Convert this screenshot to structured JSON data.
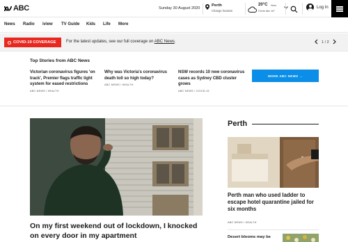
{
  "header": {
    "logo_text": "ABC",
    "date": "Sunday 30 August 2020",
    "location_name": "Perth",
    "location_change": "Change location",
    "temperature": "20°C",
    "temperature_note": "Now",
    "feels_like": "Feels like 16°",
    "login_label": "Log In"
  },
  "nav": {
    "items": [
      "News",
      "Radio",
      "iview",
      "TV Guide",
      "Kids",
      "Life",
      "More"
    ]
  },
  "banner": {
    "badge": "COVID-19 COVERAGE",
    "text": "For the latest updates, see our full coverage on",
    "link": "ABC News",
    "text_end": ".",
    "page": "1 / 2"
  },
  "top_stories": {
    "heading": "Top Stories from ABC News",
    "stories": [
      {
        "title": "Victorian coronavirus figures 'on track', Premier flags traffic light system for eased restrictions",
        "tags": "ABC NEWS  /  HEALTH"
      },
      {
        "title": "Why was Victoria's coronavirus death toll so high today?",
        "tags": "ABC NEWS  /  HEALTH"
      },
      {
        "title": "NSW records 10 new coronavirus cases as Sydney CBD cluster grows",
        "tags": "ABC NEWS  /  COVID-19"
      }
    ],
    "more_button": "MORE ABC NEWS  →"
  },
  "feature": {
    "title": "On my first weekend out of lockdown, I knocked on every door in my apartment"
  },
  "perth": {
    "heading": "Perth",
    "lead_title": "Perth man who used ladder to escape hotel quarantine jailed for six months",
    "lead_tags": "ABC NEWS  /  HEALTH",
    "second_title": "Desert blooms may be"
  },
  "colors": {
    "covid_red": "#e8271f",
    "more_blue": "#0a8ee8",
    "menu_black": "#000000"
  },
  "icons": [
    "abc-logo-icon",
    "location-pin-icon",
    "cloud-icon",
    "chevron-down-icon",
    "search-icon",
    "user-icon",
    "menu-icon",
    "virus-icon",
    "chevron-left-icon",
    "chevron-right-icon"
  ]
}
